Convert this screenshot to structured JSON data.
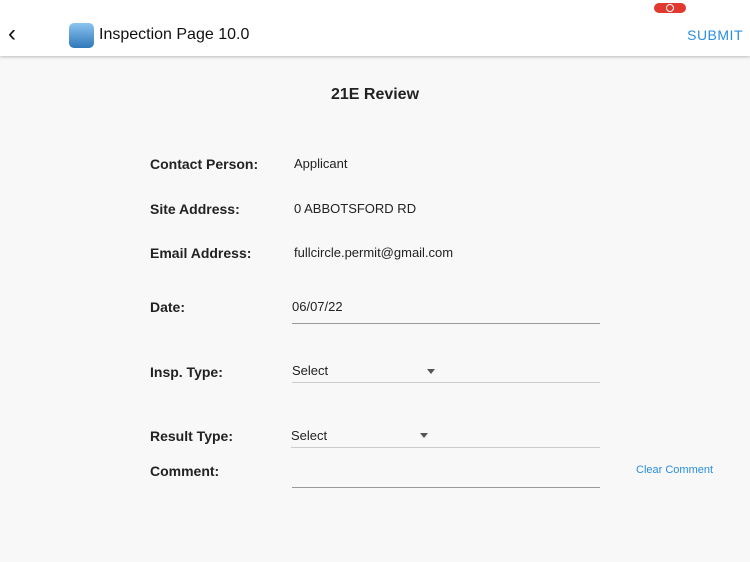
{
  "header": {
    "title": "Inspection Page 10.0",
    "submit_label": "SUBMIT"
  },
  "page": {
    "heading": "21E Review"
  },
  "form": {
    "contact_label": "Contact Person:",
    "contact_value": "Applicant",
    "site_label": "Site Address:",
    "site_value": "0 ABBOTSFORD RD",
    "email_label": "Email Address:",
    "email_value": "fullcircle.permit@gmail.com",
    "date_label": "Date:",
    "date_value": "06/07/22",
    "insp_label": "Insp. Type:",
    "insp_value": "Select",
    "result_label": "Result Type:",
    "result_value": "Select",
    "comment_label": "Comment:",
    "comment_value": "",
    "clear_comment": "Clear Comment"
  }
}
